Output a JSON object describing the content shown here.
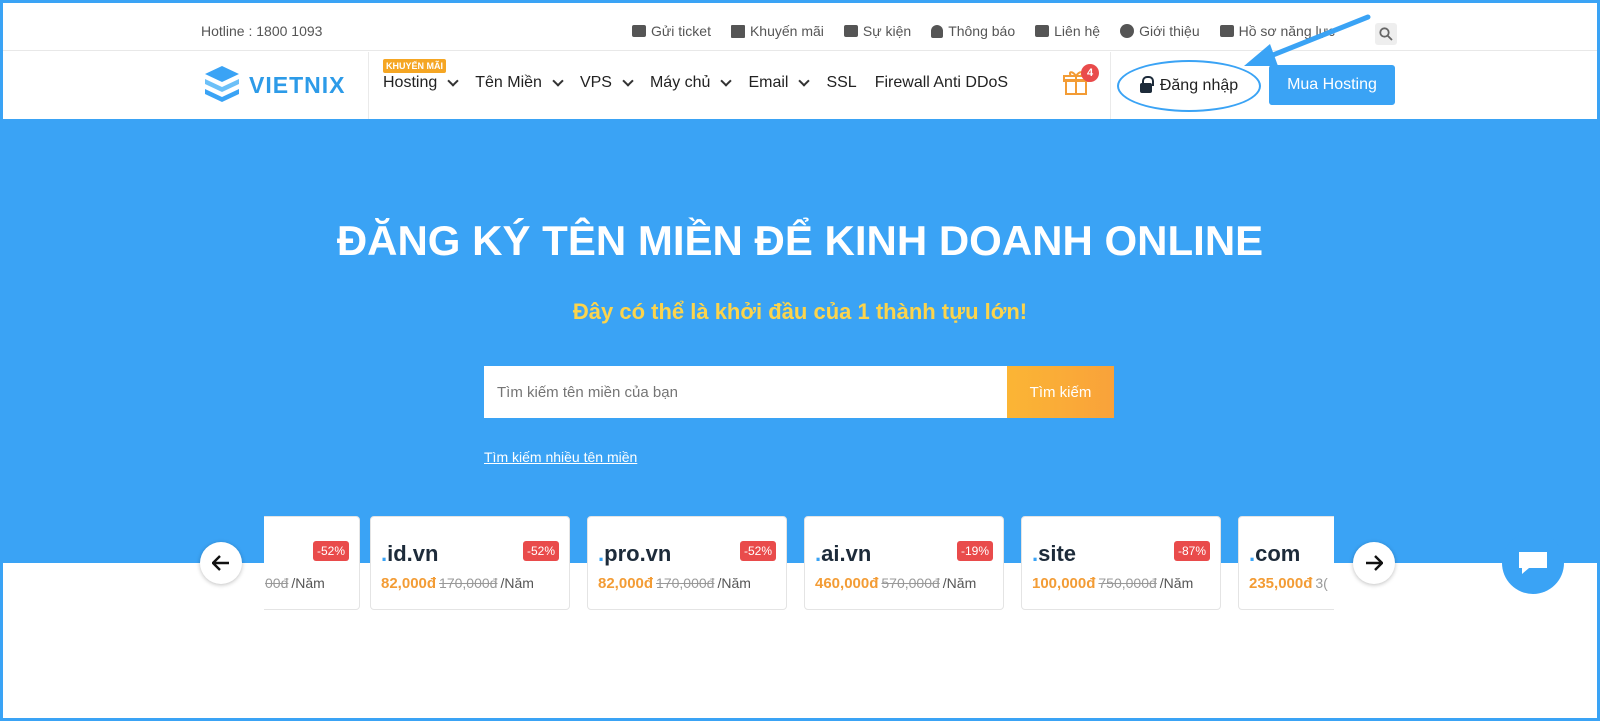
{
  "topbar": {
    "hotline": "Hotline : 1800 1093",
    "links": [
      "Gửi ticket",
      "Khuyến mãi",
      "Sự kiện",
      "Thông báo",
      "Liên hệ",
      "Giới thiệu",
      "Hồ sơ năng lực"
    ]
  },
  "header": {
    "logo_text": "VIETNIX",
    "nav": [
      "Hosting",
      "Tên Miền",
      "VPS",
      "Máy chủ",
      "Email",
      "SSL",
      "Firewall Anti DDoS"
    ],
    "promo_tag": "KHUYẾN MÃI",
    "gift_count": "4",
    "login_label": "Đăng nhập",
    "buy_label": "Mua Hosting"
  },
  "hero": {
    "title": "ĐĂNG KÝ TÊN MIỀN ĐỂ KINH DOANH ONLINE",
    "subtitle": "Đây có thể là khởi đầu của 1 thành tựu lớn!",
    "search_placeholder": "Tìm kiếm tên miền của bạn",
    "search_button": "Tìm kiếm",
    "multi_search_link": "Tìm kiếm nhiều tên miền"
  },
  "domains": [
    {
      "dot": ".",
      "name": "",
      "discount": "-52%",
      "price": "",
      "old": "00đ",
      "unit": "/Năm"
    },
    {
      "dot": ".",
      "name": "id.vn",
      "discount": "-52%",
      "price": "82,000đ",
      "old": "170,000đ",
      "unit": "/Năm"
    },
    {
      "dot": ".",
      "name": "pro.vn",
      "discount": "-52%",
      "price": "82,000đ",
      "old": "170,000đ",
      "unit": "/Năm"
    },
    {
      "dot": ".",
      "name": "ai.vn",
      "discount": "-19%",
      "price": "460,000đ",
      "old": "570,000đ",
      "unit": "/Năm"
    },
    {
      "dot": ".",
      "name": "site",
      "discount": "-87%",
      "price": "100,000đ",
      "old": "750,000đ",
      "unit": "/Năm"
    },
    {
      "dot": ".",
      "name": "com",
      "discount": "",
      "price": "235,000đ",
      "old": "3(",
      "unit": ""
    }
  ],
  "colors": {
    "brand_blue": "#3aa3f5",
    "accent_orange": "#f9a23a",
    "subtitle_yellow": "#fcd44c",
    "discount_red": "#e94b4b"
  },
  "icons": {
    "prev": "arrow-left-icon",
    "next": "arrow-right-icon",
    "chat": "chat-bubble-icon",
    "search": "search-icon",
    "gift": "gift-icon",
    "lock": "lock-icon"
  }
}
